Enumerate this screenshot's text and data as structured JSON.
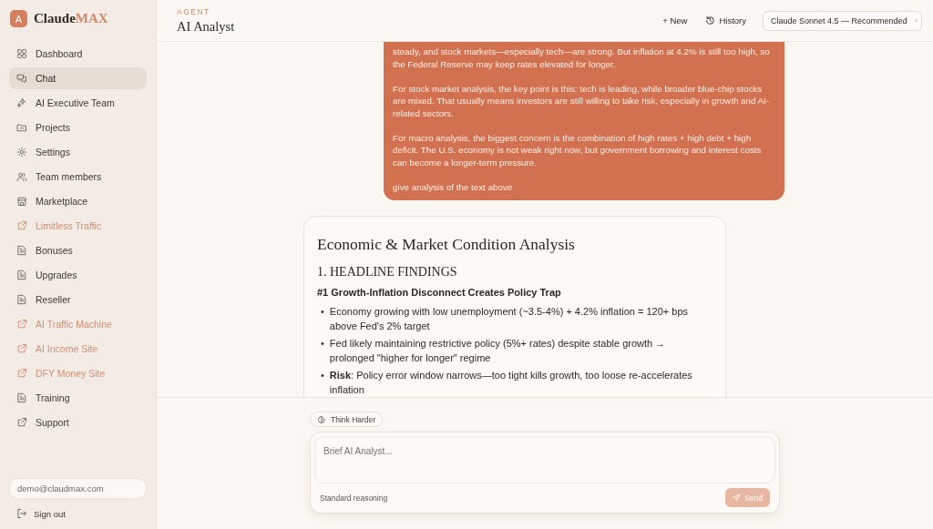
{
  "brand": {
    "avatar": "A",
    "name": "Claude",
    "accent": "MAX"
  },
  "sidebar": {
    "items": [
      {
        "label": "Dashboard",
        "kind": "page",
        "selected": false
      },
      {
        "label": "Chat",
        "kind": "page",
        "selected": true
      },
      {
        "label": "AI Executive Team",
        "kind": "page",
        "selected": false
      },
      {
        "label": "Projects",
        "kind": "page",
        "selected": false
      },
      {
        "label": "Settings",
        "kind": "page",
        "selected": false
      },
      {
        "label": "Team members",
        "kind": "page",
        "selected": false
      },
      {
        "label": "Marketplace",
        "kind": "page",
        "selected": false
      },
      {
        "label": "Limitless Traffic",
        "kind": "promo",
        "selected": false
      },
      {
        "label": "Bonuses",
        "kind": "page",
        "selected": false
      },
      {
        "label": "Upgrades",
        "kind": "page",
        "selected": false
      },
      {
        "label": "Reseller",
        "kind": "page",
        "selected": false
      },
      {
        "label": "AI Traffic Machine",
        "kind": "promo",
        "selected": false
      },
      {
        "label": "AI Income Site",
        "kind": "promo",
        "selected": false
      },
      {
        "label": "DFY Money Site",
        "kind": "promo",
        "selected": false
      },
      {
        "label": "Training",
        "kind": "page",
        "selected": false
      },
      {
        "label": "Support",
        "kind": "external",
        "selected": false
      }
    ],
    "email": "demo@claudmax.com",
    "sign_out": "Sign out"
  },
  "header": {
    "eyebrow": "AGENT",
    "title": "AI Analyst",
    "new": "+ New",
    "history": "History",
    "model": "Claude Sonnet 4.5 — Recommended"
  },
  "user_message": {
    "paragraphs": [
      "steady, and stock markets—especially tech—are strong. But inflation at 4.2% is still too high, so the Federal Reserve may keep rates elevated for longer.",
      "For stock market analysis, the key point is this: tech is leading, while broader blue-chip stocks are mixed. That usually means investors are still willing to take risk, especially in growth and AI-related sectors.",
      "For macro analysis, the biggest concern is the combination of high rates + high debt + high deficit. The U.S. economy is not weak right now, but government borrowing and interest costs can become a longer-term pressure.",
      "give analysis of the text above"
    ]
  },
  "assistant_message": {
    "title": "Economic & Market Condition Analysis",
    "section": "1. HEADLINE FINDINGS",
    "finding": "#1 Growth-Inflation Disconnect Creates Policy Trap",
    "bullets": [
      {
        "marker": "•",
        "text": "Economy growing with low unemployment (~3.5-4%) + 4.2% inflation = 120+ bps above Fed's 2% target"
      },
      {
        "marker": "•",
        "text": "Fed likely maintaining restrictive policy (5%+ rates) despite stable growth → prolonged \"higher for longer\" regime"
      },
      {
        "marker": "•",
        "text": "**Risk**: Policy error window narrows—too tight kills growth, too loose re-accelerates inflation"
      }
    ]
  },
  "composer": {
    "think_harder": "Think Harder",
    "think_on": false,
    "placeholder": "Brief AI Analyst...",
    "mode": "Standard reasoning",
    "send": "Send",
    "send_disabled": true
  }
}
